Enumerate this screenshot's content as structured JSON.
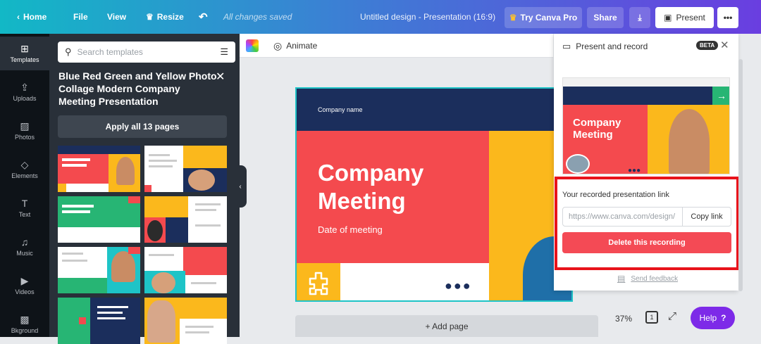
{
  "topbar": {
    "home": "Home",
    "file": "File",
    "view": "View",
    "resize": "Resize",
    "saved_status": "All changes saved",
    "doc_title": "Untitled design - Presentation (16:9)",
    "try_pro": "Try Canva Pro",
    "share": "Share",
    "present": "Present",
    "more": "•••"
  },
  "rail": {
    "items": [
      {
        "label": "Templates",
        "icon": "templates-icon"
      },
      {
        "label": "Uploads",
        "icon": "upload-icon"
      },
      {
        "label": "Photos",
        "icon": "photo-icon"
      },
      {
        "label": "Elements",
        "icon": "elements-icon"
      },
      {
        "label": "Text",
        "icon": "text-icon"
      },
      {
        "label": "Music",
        "icon": "music-icon"
      },
      {
        "label": "Videos",
        "icon": "video-icon"
      },
      {
        "label": "Bkground",
        "icon": "background-icon"
      }
    ]
  },
  "panel": {
    "search_placeholder": "Search templates",
    "title": "Blue Red Green and Yellow Photo Collage Modern Company Meeting Presentation",
    "apply_label": "Apply all 13 pages"
  },
  "toolbar": {
    "animate": "Animate"
  },
  "slide": {
    "company_name": "Company name",
    "heading_line1": "Company",
    "heading_line2": "Meeting",
    "date": "Date of meeting",
    "dots": "●●●"
  },
  "bottom": {
    "add_page": "+ Add page",
    "zoom": "37%",
    "page_number": "1",
    "help": "Help",
    "help_icon": "?"
  },
  "present_panel": {
    "title": "Present and record",
    "badge": "BETA",
    "thumb_heading_line1": "Company",
    "thumb_heading_line2": "Meeting",
    "recorded_label": "Your recorded presentation link",
    "link_value": "https://www.canva.com/design/",
    "copy_label": "Copy link",
    "delete_label": "Delete this recording",
    "feedback": "Send feedback"
  },
  "colors": {
    "navy": "#1b2e5c",
    "red": "#f44a4e",
    "yellow": "#fbb81c",
    "green": "#27b574",
    "purple": "#7d2ae8",
    "highlight": "#e8131b"
  }
}
